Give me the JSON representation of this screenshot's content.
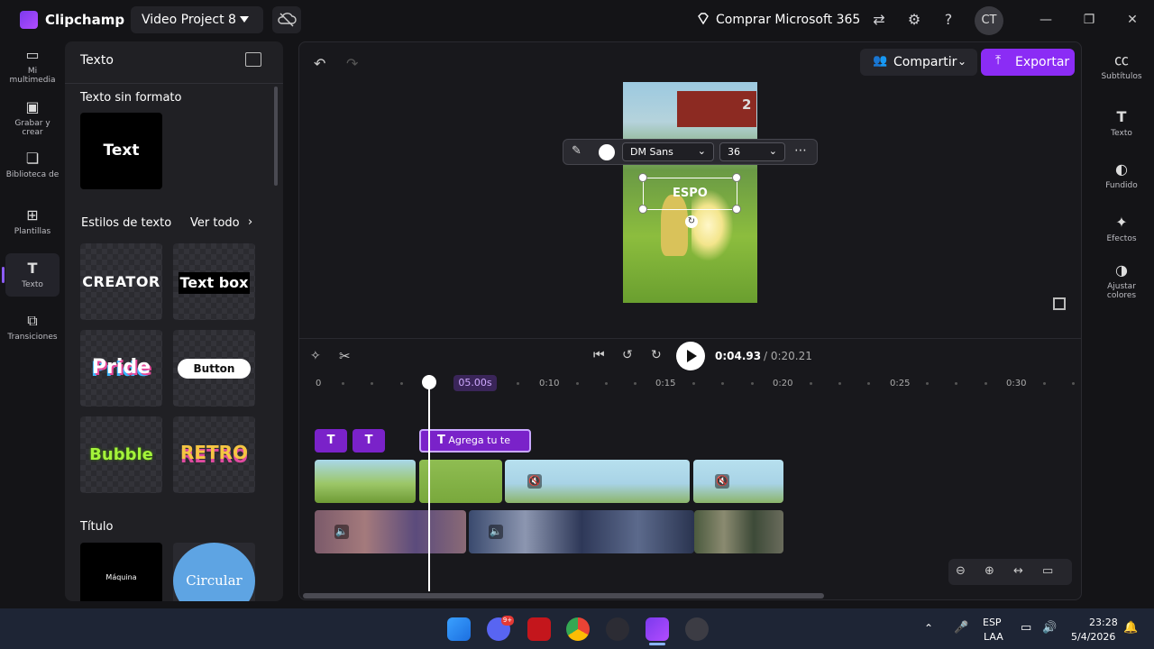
{
  "app": {
    "name": "Clipchamp",
    "project": "Video Project 8",
    "promo": "Comprar Microsoft 365",
    "avatar": "CT"
  },
  "rail": {
    "items": [
      "Mi multimedia",
      "Grabar y crear",
      "Biblioteca de",
      "Plantillas",
      "Texto",
      "Transiciones"
    ]
  },
  "panel": {
    "title": "Texto",
    "plain_section": "Texto sin formato",
    "plain_card": "Text",
    "styles_section": "Estilos de texto",
    "see_all": "Ver todo",
    "styles": [
      "CREATOR",
      "Text box",
      "Pride",
      "Button",
      "Bubble",
      "RETRO"
    ],
    "title_section": "Título",
    "title_cards": [
      "Máquina",
      "Circular"
    ]
  },
  "editor": {
    "share": "Compartir",
    "export": "Exportar",
    "font": "DM Sans",
    "size": "36",
    "overlay_text": "ESPO",
    "preview_number": "2",
    "timecode_current": "0:04.93",
    "timecode_total": "/ 0:20.21"
  },
  "timeline": {
    "ruler": [
      "0",
      "0:10",
      "0:15",
      "0:20",
      "0:25",
      "0:30"
    ],
    "marker": "05.00s",
    "clip_text": "Agrega tu te"
  },
  "right_rail": {
    "items": [
      "Subtítulos",
      "Texto",
      "Fundido",
      "Efectos",
      "Ajustar colores"
    ]
  },
  "taskbar": {
    "lang": "ESP",
    "lang2": "LAA",
    "time": "23:28",
    "date": "5/4/2026",
    "discord_badge": "9+"
  },
  "colors": {
    "accent": "#8b2cf5",
    "clip": "#7a22c9"
  }
}
